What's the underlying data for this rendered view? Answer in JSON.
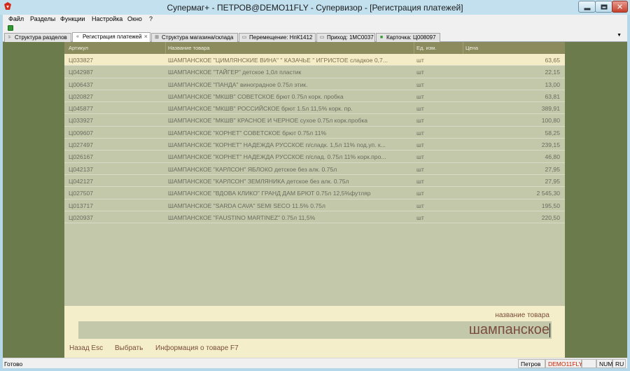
{
  "window": {
    "title": "Супермаг+ - ПЕТРОВ@DEMO11FLY - Супервизор  - [Регистрация платежей]",
    "app_icon": "app-logo-icon"
  },
  "menu": [
    "Файл",
    "Разделы",
    "Функции",
    "Настройка",
    "Окно",
    "?"
  ],
  "tabs": [
    {
      "label": "Структура разделов",
      "icon": "tree-icon"
    },
    {
      "label": "Регистрация платежей",
      "icon": "payment-icon",
      "active": true
    },
    {
      "label": "Структура магазина/склада",
      "icon": "store-icon"
    },
    {
      "label": "Перемещение: НпК1412",
      "icon": "document-icon"
    },
    {
      "label": "Приход: 1МС0037",
      "icon": "document-icon"
    },
    {
      "label": "Карточка: Ц008097",
      "icon": "card-icon"
    }
  ],
  "table": {
    "columns": [
      "Артикул",
      "Название товара",
      "Ед. изм.",
      "Цена"
    ],
    "rows": [
      {
        "article": "Ц033827",
        "name": "ШАМПАНСКОЕ \"ЦИМЛЯНСКИЕ ВИНА\" \" КАЗАЧЬЕ \" ИГРИСТОЕ сладкое 0,7...",
        "unit": "шт",
        "price": "63,65"
      },
      {
        "article": "Ц042987",
        "name": "ШАМПАНСКОЕ \"ТАЙГЕР\" детское 1,0л пластик",
        "unit": "шт",
        "price": "22,15"
      },
      {
        "article": "Ц006437",
        "name": "ШАМПАНСКОЕ \"ПАНДА\" виноградное 0.75л  этик.",
        "unit": "шт",
        "price": "13,00"
      },
      {
        "article": "Ц020827",
        "name": "ШАМПАНСКОЕ \"МКШВ\" СОВЕТСКОЕ брют 0.75л корк. пробка",
        "unit": "шт",
        "price": "63,81"
      },
      {
        "article": "Ц045877",
        "name": "ШАМПАНСКОЕ \"МКШВ\" РОССИЙСКОЕ брют 1.5л 11,5% корк. пр.",
        "unit": "шт",
        "price": "389,91"
      },
      {
        "article": "Ц033927",
        "name": "ШАМПАНСКОЕ \"МКШВ\" КРАСНОЕ И ЧЕРНОЕ сухое 0.75л корк.пробка",
        "unit": "шт",
        "price": "100,80"
      },
      {
        "article": "Ц009607",
        "name": "ШАМПАНСКОЕ \"КОРНЕТ\" СОВЕТСКОЕ брют 0.75л 11%",
        "unit": "шт",
        "price": "58,25"
      },
      {
        "article": "Ц027497",
        "name": "ШАМПАНСКОЕ \"КОРНЕТ\" НАДЕЖДА РУССКОЕ п/сладк. 1,5л 11% под.уп. к...",
        "unit": "шт",
        "price": "239,15"
      },
      {
        "article": "Ц026167",
        "name": "ШАМПАНСКОЕ \"КОРНЕТ\" НАДЕЖДА РУССКОЕ п/слад. 0.75л 11% корк.про...",
        "unit": "шт",
        "price": "46,80"
      },
      {
        "article": "Ц042137",
        "name": "ШАМПАНСКОЕ \"КАРЛСОН\" ЯБЛОКО детское без алк. 0.75л",
        "unit": "шт",
        "price": "27,95"
      },
      {
        "article": "Ц042127",
        "name": "ШАМПАНСКОЕ \"КАРЛСОН\" ЗЕМЛЯНИКА детское без алк. 0.75л",
        "unit": "шт",
        "price": "27,95"
      },
      {
        "article": "Ц027507",
        "name": "ШАМПАНСКОЕ \"ВДОВА КЛИКО\" ГРАНД ДАМ БРЮТ 0.75л 12,5%футляр",
        "unit": "шт",
        "price": "2 545,30"
      },
      {
        "article": "Ц013717",
        "name": "ШАМПАНСКОЕ \"SARDA CAVA\" SEMI SECO 11.5% 0.75л",
        "unit": "шт",
        "price": "195,50"
      },
      {
        "article": "Ц020937",
        "name": "ШАМПАНСКОЕ \"FAUSTINO MARTINEZ\" 0.75л 11,5%",
        "unit": "шт",
        "price": "220,50"
      }
    ],
    "selected_row": 0
  },
  "search": {
    "label": "название товара",
    "value": "шампанское"
  },
  "hotkeys": [
    "Назад Esc",
    "Выбрать",
    "Информация о товаре F7"
  ],
  "status": {
    "ready": "Готово",
    "user": "Петров",
    "database": "DEMO11FLY",
    "num": "NUM",
    "lang": "RU"
  },
  "colors": {
    "window_frame": "#b4d8ea",
    "background": "#6b7b4b",
    "table_bg": "#c3c8ab",
    "header_bg": "#8c8b5d",
    "selected_row": "#f3ecc6",
    "search_panel": "#f4efca",
    "accent_text": "#7a4d3c",
    "database_text": "#cc2200"
  }
}
